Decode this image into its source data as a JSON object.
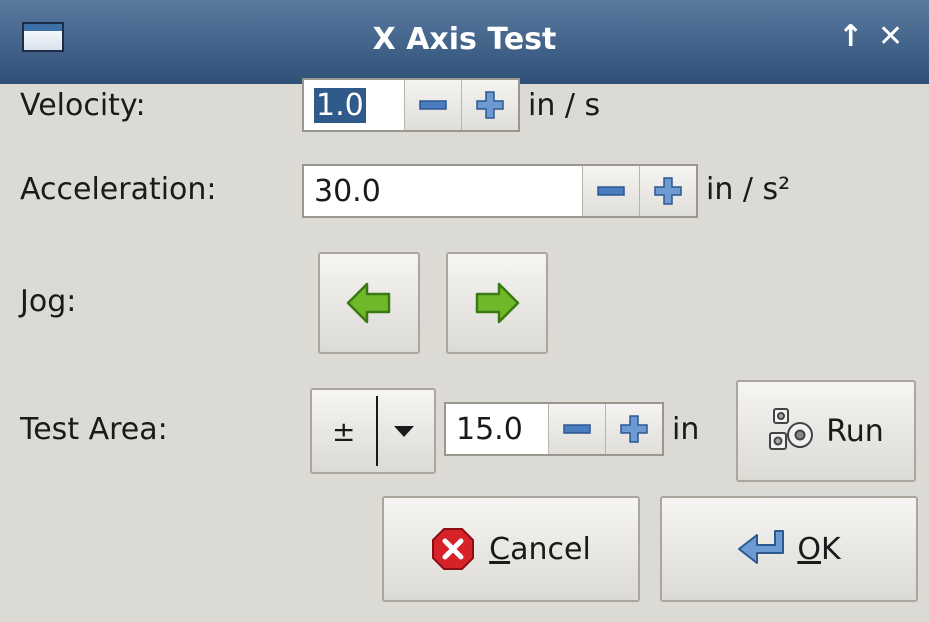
{
  "window": {
    "title": "X Axis Test",
    "maximize_icon": "↑",
    "close_icon": "✕"
  },
  "velocity": {
    "label": "Velocity:",
    "value": "1.0",
    "unit": "in / s"
  },
  "acceleration": {
    "label": "Acceleration:",
    "value": "30.0",
    "unit": "in / s²"
  },
  "jog": {
    "label": "Jog:",
    "left_icon": "arrow-left-icon",
    "right_icon": "arrow-right-icon"
  },
  "test_area": {
    "label": "Test Area:",
    "sign_value": "±",
    "value": "15.0",
    "unit": "in",
    "run_label": "Run"
  },
  "buttons": {
    "cancel_mnemonic": "C",
    "cancel_rest": "ancel",
    "ok_mnemonic": "O",
    "ok_rest": "K"
  },
  "colors": {
    "titlebar": "#3e6088",
    "arrow_green": "#6fb82a",
    "cancel_red": "#d8222a",
    "spin_blue": "#4a7cc0"
  }
}
